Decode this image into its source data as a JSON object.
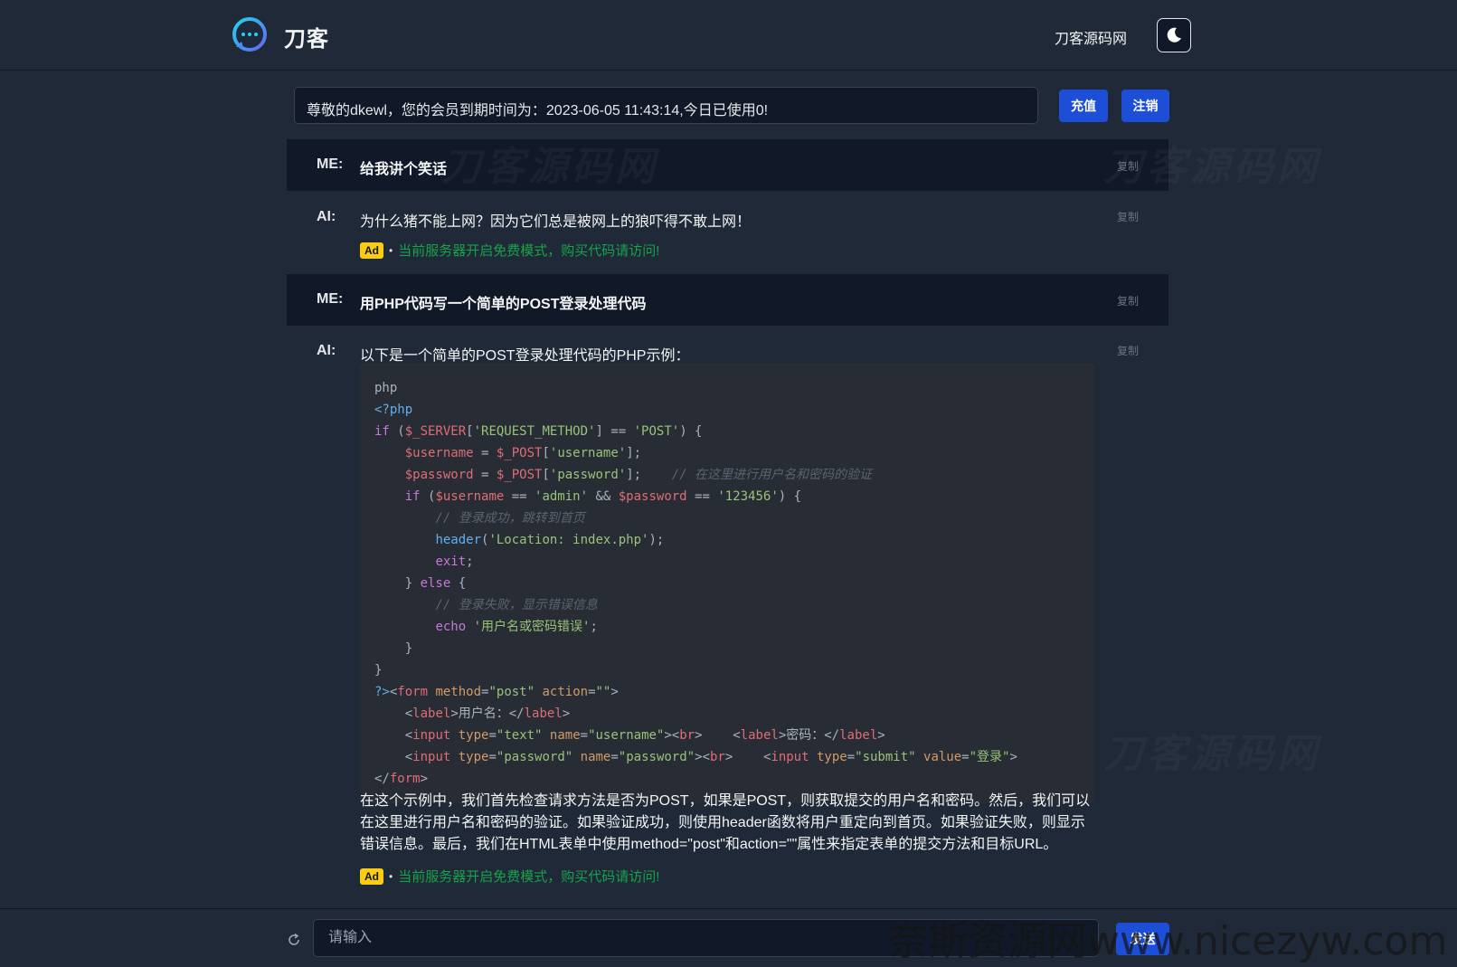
{
  "header": {
    "brand": "刀客",
    "site_link": "刀客源码网",
    "theme_icon": "moon-icon"
  },
  "notice": {
    "text": "尊敬的dkewl，您的会员到期时间为：2023-06-05 11:43:14,今日已使用0!",
    "recharge_label": "充值",
    "logout_label": "注销"
  },
  "chat": {
    "messages": [
      {
        "role": "ME:",
        "text": "给我讲个笑话",
        "copy": "复制"
      },
      {
        "role": "AI:",
        "text": "为什么猪不能上网？因为它们总是被网上的狼吓得不敢上网！",
        "copy": "复制",
        "ad": {
          "badge": "Ad",
          "text": "当前服务器开启免费模式，购买代码请访问!"
        }
      },
      {
        "role": "ME:",
        "text": "用PHP代码写一个简单的POST登录处理代码",
        "copy": "复制"
      },
      {
        "role": "AI:",
        "text": "以下是一个简单的POST登录处理代码的PHP示例：",
        "copy": "复制",
        "explanation": "在这个示例中，我们首先检查请求方法是否为POST，如果是POST，则获取提交的用户名和密码。然后，我们可以在这里进行用户名和密码的验证。如果验证成功，则使用header函数将用户重定向到首页。如果验证失败，则显示错误信息。最后，我们在HTML表单中使用method=\"post\"和action=\"\"属性来指定表单的提交方法和目标URL。",
        "ad": {
          "badge": "Ad",
          "text": "当前服务器开启免费模式，购买代码请访问!"
        }
      }
    ]
  },
  "input": {
    "placeholder": "请输入",
    "send_label": "发送",
    "refresh_icon": "refresh-icon"
  },
  "watermark": {
    "text": "刀客源码网",
    "footer_text": "奈斯资源网www.nicezyw.com"
  },
  "colors": {
    "background": "#1f2937",
    "panel_dark": "#111827",
    "accent_blue": "#1d4ed8",
    "ad_green": "#16a34a",
    "ad_badge": "#facc15"
  }
}
